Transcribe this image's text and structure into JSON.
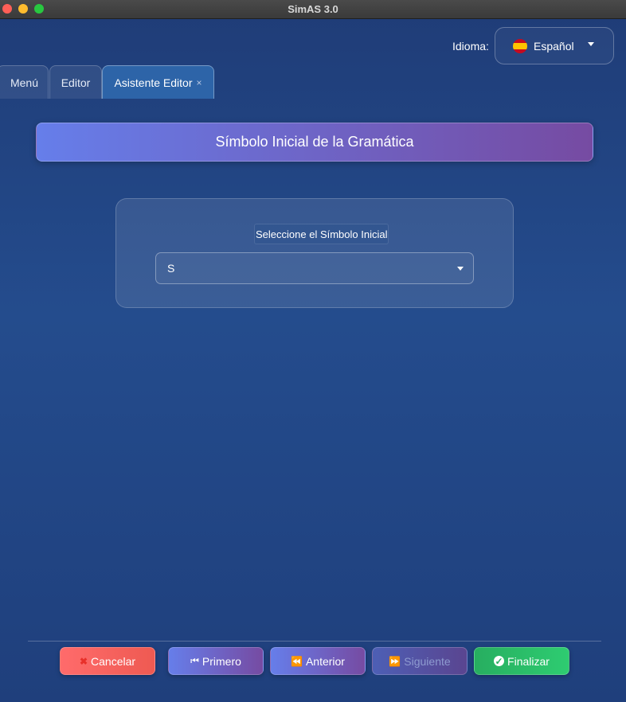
{
  "window": {
    "title": "SimAS 3.0"
  },
  "language": {
    "label": "Idioma:",
    "selected": "Español",
    "flag_icon": "spain-flag-icon"
  },
  "tabs": [
    {
      "label": "Menú",
      "active": false
    },
    {
      "label": "Editor",
      "active": false
    },
    {
      "label": "Asistente Editor",
      "active": true,
      "close": "×"
    }
  ],
  "header": {
    "title": "Símbolo Inicial de la Gramática"
  },
  "form": {
    "label": "Seleccione el Símbolo Inicial",
    "selected_symbol": "S"
  },
  "buttons": {
    "cancel": "Cancelar",
    "first": "Primero",
    "previous": "Anterior",
    "next": "Siguiente",
    "finish": "Finalizar"
  },
  "colors": {
    "background": "#244c8d",
    "accent_gradient_start": "#667eea",
    "accent_gradient_end": "#764ba2",
    "cancel": "#ff6b6b",
    "finish": "#2ecc71"
  }
}
